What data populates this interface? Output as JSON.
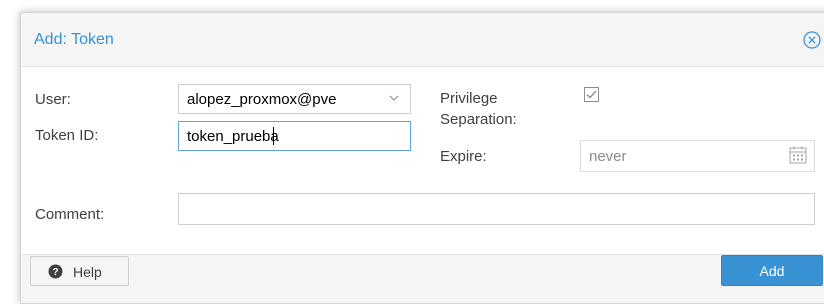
{
  "dialog": {
    "title": "Add: Token",
    "close_icon": "close-circle-icon"
  },
  "form": {
    "user_label": "User:",
    "user_value": "alopez_proxmox@pve",
    "token_id_label": "Token ID:",
    "token_id_value": "token_prueba",
    "privilege_label_line1": "Privilege",
    "privilege_label_line2": "Separation:",
    "privilege_checked": true,
    "expire_label": "Expire:",
    "expire_value": "never",
    "comment_label": "Comment:",
    "comment_value": ""
  },
  "footer": {
    "help_label": "Help",
    "help_icon": "question-circle-icon",
    "add_label": "Add"
  },
  "colors": {
    "accent": "#3892d4",
    "focus_border": "#5fa2dd"
  }
}
